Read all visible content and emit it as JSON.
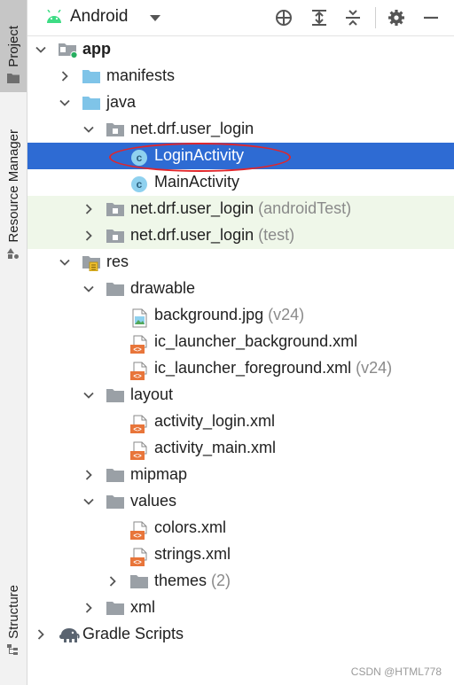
{
  "left_strip": {
    "project_tab": "Project",
    "resource_manager_tab": "Resource Manager",
    "structure_tab": "Structure"
  },
  "header": {
    "view_mode": "Android"
  },
  "tree": [
    {
      "label": "app",
      "suffix": "",
      "depth": 0,
      "arrow": "down",
      "icon": "app-module-icon",
      "state": "normal",
      "bold": true
    },
    {
      "label": "manifests",
      "suffix": "",
      "depth": 1,
      "arrow": "right",
      "icon": "blue-folder-icon",
      "state": "normal"
    },
    {
      "label": "java",
      "suffix": "",
      "depth": 1,
      "arrow": "down",
      "icon": "blue-folder-icon",
      "state": "normal"
    },
    {
      "label": "net.drf.user_login",
      "suffix": "",
      "depth": 2,
      "arrow": "down",
      "icon": "package-folder-icon",
      "state": "normal"
    },
    {
      "label": "LoginActivity",
      "suffix": "",
      "depth": 3,
      "arrow": "none",
      "icon": "class-icon",
      "state": "selected"
    },
    {
      "label": "MainActivity",
      "suffix": "",
      "depth": 3,
      "arrow": "none",
      "icon": "class-icon",
      "state": "normal"
    },
    {
      "label": "net.drf.user_login",
      "suffix": "(androidTest)",
      "depth": 2,
      "arrow": "right",
      "icon": "package-folder-icon",
      "state": "green"
    },
    {
      "label": "net.drf.user_login",
      "suffix": "(test)",
      "depth": 2,
      "arrow": "right",
      "icon": "package-folder-icon",
      "state": "green"
    },
    {
      "label": "res",
      "suffix": "",
      "depth": 1,
      "arrow": "down",
      "icon": "res-folder-icon",
      "state": "normal"
    },
    {
      "label": "drawable",
      "suffix": "",
      "depth": 2,
      "arrow": "down",
      "icon": "gray-folder-icon",
      "state": "normal"
    },
    {
      "label": "background.jpg",
      "suffix": "(v24)",
      "depth": 3,
      "arrow": "none",
      "icon": "image-file-icon",
      "state": "normal"
    },
    {
      "label": "ic_launcher_background.xml",
      "suffix": "",
      "depth": 3,
      "arrow": "none",
      "icon": "xml-file-icon",
      "state": "normal"
    },
    {
      "label": "ic_launcher_foreground.xml",
      "suffix": "(v24)",
      "depth": 3,
      "arrow": "none",
      "icon": "xml-file-icon",
      "state": "normal"
    },
    {
      "label": "layout",
      "suffix": "",
      "depth": 2,
      "arrow": "down",
      "icon": "gray-folder-icon",
      "state": "normal"
    },
    {
      "label": "activity_login.xml",
      "suffix": "",
      "depth": 3,
      "arrow": "none",
      "icon": "xml-file-icon",
      "state": "normal"
    },
    {
      "label": "activity_main.xml",
      "suffix": "",
      "depth": 3,
      "arrow": "none",
      "icon": "xml-file-icon",
      "state": "normal"
    },
    {
      "label": "mipmap",
      "suffix": "",
      "depth": 2,
      "arrow": "right",
      "icon": "gray-folder-icon",
      "state": "normal"
    },
    {
      "label": "values",
      "suffix": "",
      "depth": 2,
      "arrow": "down",
      "icon": "gray-folder-icon",
      "state": "normal"
    },
    {
      "label": "colors.xml",
      "suffix": "",
      "depth": 3,
      "arrow": "none",
      "icon": "xml-file-icon",
      "state": "normal"
    },
    {
      "label": "strings.xml",
      "suffix": "",
      "depth": 3,
      "arrow": "none",
      "icon": "xml-file-icon",
      "state": "normal"
    },
    {
      "label": "themes",
      "suffix": "(2)",
      "depth": 3,
      "arrow": "right",
      "icon": "gray-folder-icon",
      "state": "normal"
    },
    {
      "label": "xml",
      "suffix": "",
      "depth": 2,
      "arrow": "right",
      "icon": "gray-folder-icon",
      "state": "normal"
    },
    {
      "label": "Gradle Scripts",
      "suffix": "",
      "depth": 0,
      "arrow": "right",
      "icon": "gradle-elephant-icon",
      "state": "normal"
    }
  ],
  "watermark": "CSDN @HTML778",
  "colors": {
    "selection": "#2e6bd3",
    "test_source_bg": "#eff7e9",
    "highlight_ellipse": "#e0262c"
  }
}
